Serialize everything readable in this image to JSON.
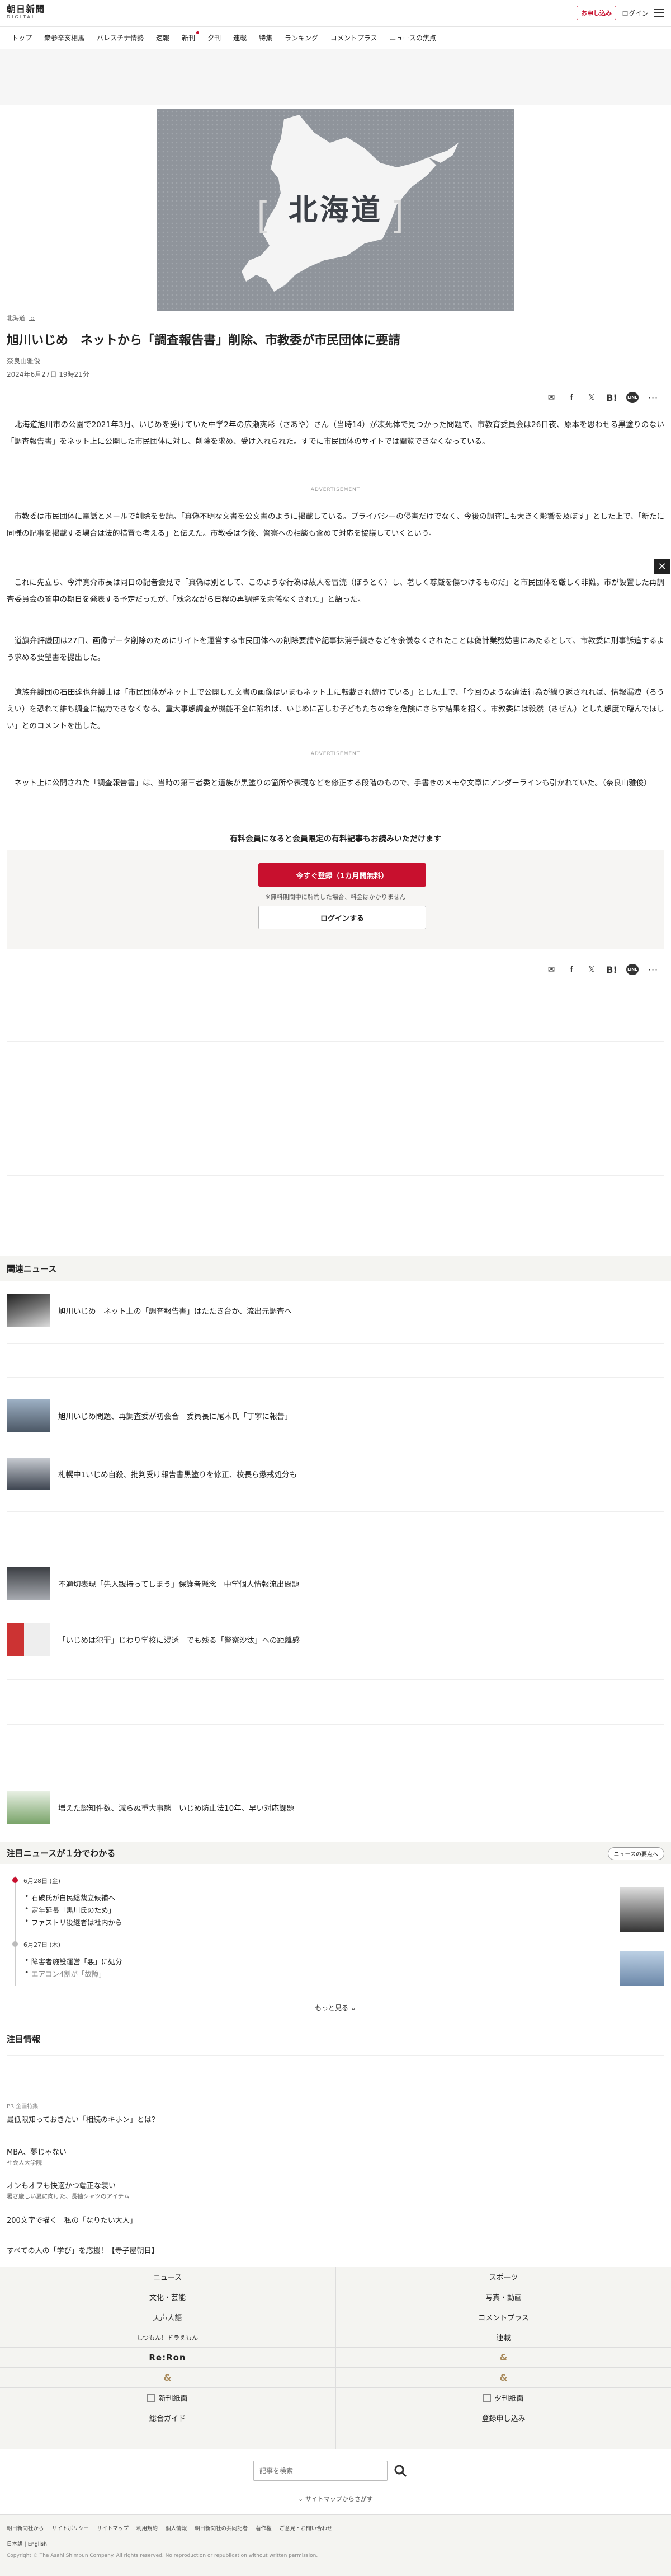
{
  "header": {
    "logo_main": "朝日新聞",
    "logo_sub": "DIGITAL",
    "apply_label": "お申し込み",
    "login_label": "ログイン"
  },
  "nav": [
    "トップ",
    "衆参辛亥相馬",
    "パレスチナ情勢",
    "速報",
    "新刊",
    "夕刊",
    "連載",
    "特集",
    "ランキング",
    "コメントプラス",
    "ニュースの焦点"
  ],
  "hero": {
    "label": "北海道"
  },
  "article": {
    "category": "北海道",
    "title": "旭川いじめ　ネットから「調査報告書」削除、市教委が市民団体に要請",
    "byline": "奈良山雅俊",
    "date": "2024年6月27日 19時21分",
    "paragraphs": [
      "　北海道旭川市の公園で2021年3月、いじめを受けていた中学2年の広瀬爽彩（さあや）さん（当時14）が凍死体で見つかった問題で、市教育委員会は26日夜、原本を思わせる黒塗りのない「調査報告書」をネット上に公開した市民団体に対し、削除を求め、受け入れられた。すでに市民団体のサイトでは閲覧できなくなっている。",
      "　市教委は市民団体に電話とメールで削除を要請。「真偽不明な文書を公文書のように掲載している。プライバシーの侵害だけでなく、今後の調査にも大きく影響を及ぼす」とした上で、「新たに同様の記事を掲載する場合は法的措置も考える」と伝えた。市教委は今後、警察への相談も含めて対応を協議していくという。",
      "　これに先立ち、今津寛介市長は同日の記者会見で「真偽は別として、このような行為は故人を冒涜（ぼうとく）し、著しく尊厳を傷つけるものだ」と市民団体を厳しく非難。市が設置した再調査委員会の答申の期日を発表する予定だったが、「残念ながら日程の再調整を余儀なくされた」と語った。",
      "　道旗弁評議団は27日、画像データ削除のためにサイトを運営する市民団体への削除要請や記事抹消手続きなどを余儀なくされたことは偽計業務妨害にあたるとして、市教委に刑事訴追するよう求める要望書を提出した。",
      "　遺族弁護団の石田達也弁護士は「市民団体がネット上で公開した文書の画像はいまもネット上に転載され続けている」とした上で、「今回のような違法行為が繰り返されれば、情報漏洩（ろうえい）を恐れて誰も調査に協力できなくなる。重大事態調査が機能不全に陥れば、いじめに苦しむ子どもたちの命を危険にさらす結果を招く。市教委には毅然（きぜん）とした態度で臨んでほしい」とのコメントを出した。",
      "　ネット上に公開された「調査報告書」は、当時の第三者委と遺族が黒塗りの箇所や表現などを修正する段階のもので、手書きのメモや文章にアンダーラインも引かれていた。（奈良山雅俊）"
    ],
    "ad_label": "ADVERTISEMENT"
  },
  "paywall": {
    "title": "有料会員になると会員限定の有料記事もお読みいただけます",
    "register_label": "今すぐ登録（1カ月間無料）",
    "note": "※無料期間中に解約した場合、料金はかかりません",
    "login_label": "ログインする"
  },
  "related": {
    "heading": "関連ニュース",
    "items": [
      "旭川いじめ　ネット上の「調査報告書」はたたき台か、流出元調査へ",
      "旭川いじめ問題、再調査委が初会合　委員長に尾木氏「丁寧に報告」",
      "札幌中1いじめ自殺、批判受け報告書黒塗りを修正、校長ら懲戒処分も",
      "不適切表現「先入観持ってしまう」保護者懸念　中学個人情報流出問題",
      "「いじめは犯罪」じわり学校に浸透　でも残る「警察沙汰」への距離感",
      "増えた認知件数、減らぬ重大事態　いじめ防止法10年、早い対応課題"
    ]
  },
  "attention": {
    "heading": "注目ニュースが１分でわかる",
    "more_btn": "ニュースの要点へ",
    "days": [
      {
        "date": "6月28日 (金)",
        "items": [
          "石破氏が自民総裁立候補へ",
          "定年延長「黒川氏のため」",
          "ファストリ後継者は社内から"
        ]
      },
      {
        "date": "6月27日 (木)",
        "items": [
          "障害者施設運営「悪」に処分",
          "エアコン4割が「故障」"
        ]
      }
    ],
    "more_link": "もっと見る"
  },
  "info": {
    "heading": "注目情報",
    "pr": "PR 企画特集",
    "items": [
      {
        "title": "最低限知っておきたい「相続のキホン」とは？",
        "sub": ""
      },
      {
        "title": "MBA、夢じゃない",
        "sub": "社会人大学院"
      },
      {
        "title": "オンもオフも快適かつ端正な装い",
        "sub": "暑さ厳しい夏に向けた、長袖シャツのアイテム"
      },
      {
        "title": "200文字で描く　私の「なりたい大人」",
        "sub": ""
      },
      {
        "title": "すべての人の「学び」を応援！【寺子屋朝日】",
        "sub": ""
      }
    ]
  },
  "footer_nav": {
    "left": [
      "ニュース",
      "文化・芸能",
      "天声人語",
      "しつもん！ドラえもん",
      "Re:Ron",
      "",
      "新刊紙面",
      "総合ガイド"
    ],
    "right": [
      "スポーツ",
      "写真・動画",
      "コメントプラス",
      "連載",
      "&",
      "&",
      "夕刊紙面",
      "登録申し込み"
    ]
  },
  "search": {
    "placeholder": "記事を検索"
  },
  "sitemap": "サイトマップからさがす",
  "footer": {
    "links": [
      "朝日新聞社から",
      "サイトポリシー",
      "サイトマップ",
      "利用規約",
      "個人情報",
      "朝日新聞社の共同記者",
      "著作権",
      "ご意見・お問い合わせ"
    ],
    "lang": "日本語 | English",
    "copyright": "Copyright © The Asahi Shimbun Company. All rights reserved. No reproduction or republication without written permission."
  },
  "colors": {
    "accent": "#c8102e",
    "muted_bg": "#f4f4f1"
  }
}
